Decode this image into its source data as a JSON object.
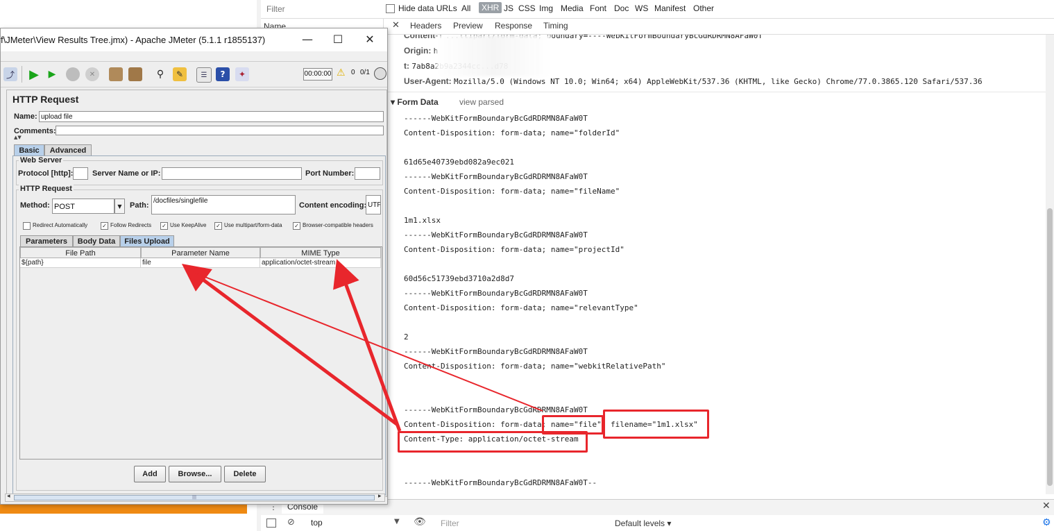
{
  "jmeter": {
    "title": "f\\JMeter\\View Results Tree.jmx) - Apache JMeter (5.1.1 r1855137)",
    "window_buttons": {
      "minimize": "—",
      "maximize": "☐",
      "close": "✕"
    },
    "toolbar": {
      "timer": "00:00:00",
      "warn_count": "0",
      "threads": "0/1"
    },
    "sampler_title": "HTTP Request",
    "name_label": "Name:",
    "name_value": "upload file",
    "comments_label": "Comments:",
    "tabs": {
      "basic": "Basic",
      "advanced": "Advanced"
    },
    "web_server": {
      "group_label": "Web Server",
      "protocol_label": "Protocol [http]:",
      "protocol_value": "",
      "server_label": "Server Name or IP:",
      "server_value": "",
      "port_label": "Port Number:",
      "port_value": ""
    },
    "http_request": {
      "group_label": "HTTP Request",
      "method_label": "Method:",
      "method_value": "POST",
      "path_label": "Path:",
      "path_value": "/docfiles/singlefile",
      "encoding_label": "Content encoding:",
      "encoding_value": "UTF"
    },
    "options": [
      {
        "label": "Redirect Automatically",
        "checked": false,
        "mark": ""
      },
      {
        "label": "Follow Redirects",
        "checked": true,
        "mark": "✓"
      },
      {
        "label": "Use KeepAlive",
        "checked": true,
        "mark": "✓"
      },
      {
        "label": "Use multipart/form-data",
        "checked": true,
        "mark": "✓"
      },
      {
        "label": "Browser-compatible headers",
        "checked": true,
        "mark": "✓"
      }
    ],
    "subtabs": {
      "parameters": "Parameters",
      "body_data": "Body Data",
      "files_upload": "Files Upload"
    },
    "files_table": {
      "headers": [
        "File Path",
        "Parameter Name",
        "MIME Type"
      ],
      "rows": [
        [
          "${path}",
          "file",
          "application/octet-stream"
        ]
      ]
    },
    "buttons": {
      "add": "Add",
      "browse": "Browse...",
      "delete": "Delete"
    },
    "scroll_grip": "|||"
  },
  "devtools": {
    "filter_placeholder": "Filter",
    "hide_data_urls": "Hide data URLs",
    "types": [
      "All",
      "XHR",
      "JS",
      "CSS",
      "Img",
      "Media",
      "Font",
      "Doc",
      "WS",
      "Manifest",
      "Other"
    ],
    "active_type": "XHR",
    "name_column": "Name",
    "close_icon": "✕",
    "detail_tabs": [
      "Headers",
      "Preview",
      "Response",
      "Timing"
    ],
    "headers": {
      "content_type_partial_key": "Content-T",
      "content_type_partial_value": "...ltipart/form-data; boundary=----WebKitFormBoundaryBcGdRDRMN8AFaW0T",
      "origin_key": "Origin:",
      "origin_value": "h",
      "t_key": "t:",
      "t_value": "7ab8a2b9a2344cc...d78",
      "ua_key": "User-Agent:",
      "ua_value": "Mozilla/5.0 (Windows NT 10.0; Win64; x64) AppleWebKit/537.36 (KHTML, like Gecko) Chrome/77.0.3865.120 Safari/537.36"
    },
    "form_data": {
      "section_label": "▾ Form Data",
      "view_parsed": "view parsed",
      "lines": [
        "------WebKitFormBoundaryBcGdRDRMN8AFaW0T",
        "Content-Disposition: form-data; name=\"folderId\"",
        "",
        "61d65e40739ebd082a9ec021",
        "------WebKitFormBoundaryBcGdRDRMN8AFaW0T",
        "Content-Disposition: form-data; name=\"fileName\"",
        "",
        "1m1.xlsx",
        "------WebKitFormBoundaryBcGdRDRMN8AFaW0T",
        "Content-Disposition: form-data; name=\"projectId\"",
        "",
        "60d56c51739ebd3710a2d8d7",
        "------WebKitFormBoundaryBcGdRDRMN8AFaW0T",
        "Content-Disposition: form-data; name=\"relevantType\"",
        "",
        "2",
        "------WebKitFormBoundaryBcGdRDRMN8AFaW0T",
        "Content-Disposition: form-data; name=\"webkitRelativePath\"",
        "",
        "",
        "------WebKitFormBoundaryBcGdRDRMN8AFaW0T",
        "Content-Disposition: form-data; name=\"file\"; filename=\"1m1.xlsx\"",
        "Content-Type: application/octet-stream",
        "",
        "",
        "------WebKitFormBoundaryBcGdRDRMN8AFaW0T--"
      ]
    },
    "console": {
      "tab": "Console",
      "context": "top",
      "filter_placeholder": "Filter",
      "levels": "Default levels ▾"
    }
  },
  "colors": {
    "highlight": "#e8262c",
    "accent_orange": "#ef8a13"
  }
}
